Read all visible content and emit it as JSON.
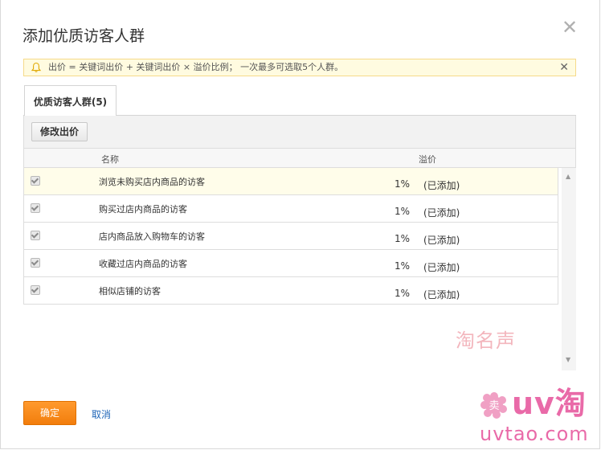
{
  "dialog": {
    "title": "添加优质访客人群",
    "close_icon": "✕"
  },
  "notice": {
    "text": "出价 = 关键词出价 + 关键词出价 × 溢价比例； 一次最多可选取5个人群。",
    "close": "✕"
  },
  "tab": {
    "label": "优质访客人群(5)"
  },
  "toolbar": {
    "edit_label": "修改出价"
  },
  "table": {
    "col_name": "名称",
    "col_premium": "溢价",
    "rows": [
      {
        "name": "浏览未购买店内商品的访客",
        "premium": "1%",
        "status": "(已添加)",
        "checked": true
      },
      {
        "name": "购买过店内商品的访客",
        "premium": "1%",
        "status": "(已添加)",
        "checked": true
      },
      {
        "name": "店内商品放入购物车的访客",
        "premium": "1%",
        "status": "(已添加)",
        "checked": true
      },
      {
        "name": "收藏过店内商品的访客",
        "premium": "1%",
        "status": "(已添加)",
        "checked": true
      },
      {
        "name": "相似店铺的访客",
        "premium": "1%",
        "status": "(已添加)",
        "checked": true
      }
    ]
  },
  "footer": {
    "ok_label": "确定",
    "cancel_label": "取消"
  },
  "watermarks": {
    "center": "淘名声",
    "logo_char": "卖",
    "brand": "uv淘",
    "url": "uvtao.com"
  },
  "colors": {
    "accent_orange": "#f58a1f",
    "notice_bg": "#fffbe0",
    "link_blue": "#2066b8",
    "watermark_pink": "#e96aa8"
  }
}
